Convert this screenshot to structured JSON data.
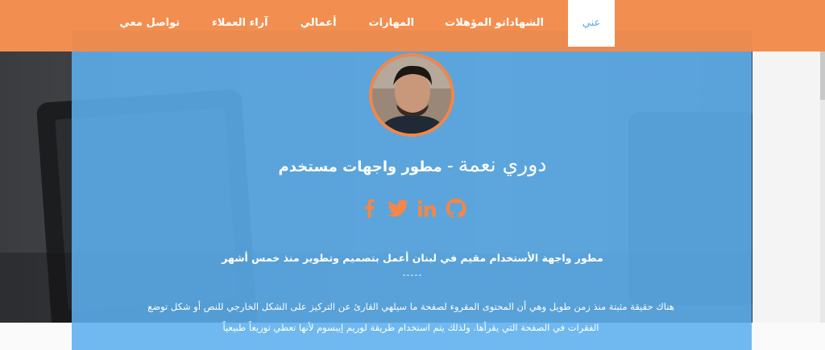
{
  "nav": {
    "items": [
      {
        "label": "عني",
        "active": true
      },
      {
        "label": "الشهاداتو المؤهلات"
      },
      {
        "label": "المهارات"
      },
      {
        "label": "أعمالي"
      },
      {
        "label": "آراء العملاء"
      },
      {
        "label": "تواصل معي"
      }
    ]
  },
  "profile": {
    "name": "دوري نعمة",
    "separator": "-",
    "role": "مطور واجهات مستخدم"
  },
  "social": [
    {
      "icon": "facebook-icon"
    },
    {
      "icon": "twitter-icon"
    },
    {
      "icon": "linkedin-icon"
    },
    {
      "icon": "github-icon"
    }
  ],
  "intro": "مطور واجهة الأستخدام مقيم في لبنان أعمل بتصميم وتطوير منذ خمس أشهر",
  "divider": "-----",
  "paragraph": "هناك حقيقة مثبتة منذ زمن طويل وهي أن المحتوى المقروء لصفحة ما سيلهي القارئ عن التركيز على الشكل الخارجي للنص أو شكل توضع الفقرات في الصفحة التي يقرأها. ولذلك يتم استخدام طريقة لوريم إيبسوم لأنها تعطي توزيعاً طبيعياً",
  "colors": {
    "navbar": "#f1894a",
    "panel": "#5cafee",
    "accent": "#f1874a",
    "active_text": "#5aa9e6"
  }
}
